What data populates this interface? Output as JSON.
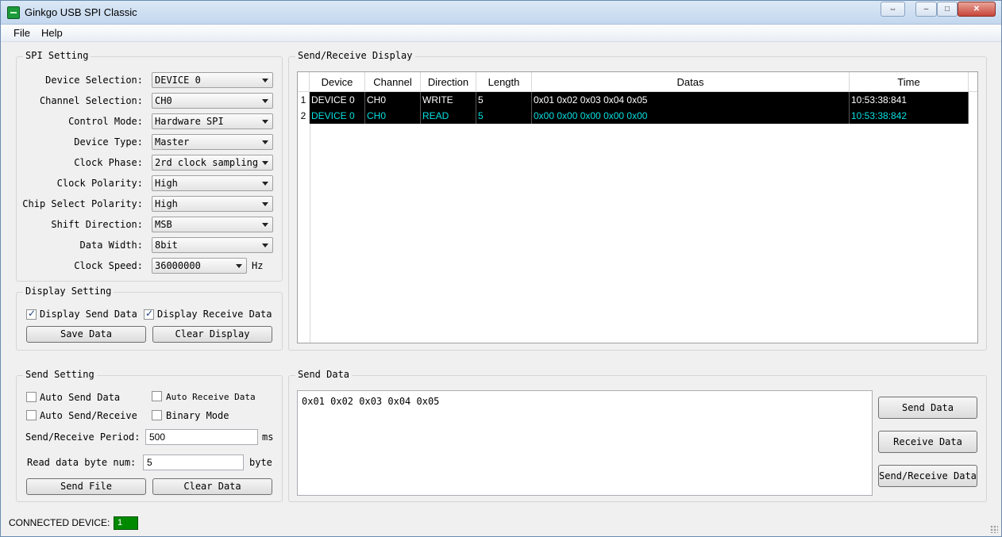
{
  "window": {
    "title": "Ginkgo USB SPI Classic",
    "restore_glyph": "⇔",
    "min_glyph": "–",
    "max_glyph": "□",
    "close_glyph": "✕"
  },
  "menu": {
    "file": "File",
    "help": "Help"
  },
  "spi_setting": {
    "title": "SPI Setting",
    "fields": [
      {
        "label": "Device Selection:",
        "value": "DEVICE 0"
      },
      {
        "label": "Channel Selection:",
        "value": "CH0"
      },
      {
        "label": "Control Mode:",
        "value": "Hardware SPI"
      },
      {
        "label": "Device Type:",
        "value": "Master"
      },
      {
        "label": "Clock Phase:",
        "value": "2rd clock sampling"
      },
      {
        "label": "Clock Polarity:",
        "value": "High"
      },
      {
        "label": "Chip Select Polarity:",
        "value": "High"
      },
      {
        "label": "Shift Direction:",
        "value": "MSB"
      },
      {
        "label": "Data Width:",
        "value": "8bit"
      },
      {
        "label": "Clock Speed:",
        "value": "36000000",
        "unit": "Hz"
      }
    ]
  },
  "display_setting": {
    "title": "Display Setting",
    "display_send": "Display Send Data",
    "display_receive": "Display Receive Data",
    "save_data": "Save Data",
    "clear_display": "Clear Display"
  },
  "send_setting": {
    "title": "Send Setting",
    "auto_send": "Auto Send Data",
    "auto_receive": "Auto Receive Data",
    "auto_send_receive": "Auto Send/Receive",
    "binary_mode": "Binary Mode",
    "period_label": "Send/Receive Period:",
    "period_value": "500",
    "period_unit": "ms",
    "read_label": "Read data byte num:",
    "read_value": "5",
    "read_unit": "byte",
    "send_file": "Send File",
    "clear_data": "Clear Data"
  },
  "display_panel": {
    "title": "Send/Receive Display",
    "columns": [
      "Device",
      "Channel",
      "Direction",
      "Length",
      "Datas",
      "Time"
    ],
    "rows": [
      {
        "num": "1",
        "device": "DEVICE 0",
        "channel": "CH0",
        "direction": "WRITE",
        "length": "5",
        "datas": "0x01 0x02 0x03 0x04 0x05",
        "time": "10:53:38:841"
      },
      {
        "num": "2",
        "device": "DEVICE 0",
        "channel": "CH0",
        "direction": "READ",
        "length": "5",
        "datas": "0x00 0x00 0x00 0x00 0x00",
        "time": "10:53:38:842"
      }
    ],
    "colors": {
      "write_row": "#ffffff",
      "read_row": "#00e0e0"
    }
  },
  "send_data": {
    "title": "Send Data",
    "text": "0x01 0x02 0x03 0x04 0x05",
    "send_button": "Send Data",
    "receive_button": "Receive Data",
    "send_receive_button": "Send/Receive Data"
  },
  "status": {
    "label": "CONNECTED DEVICE:",
    "count": "1"
  }
}
